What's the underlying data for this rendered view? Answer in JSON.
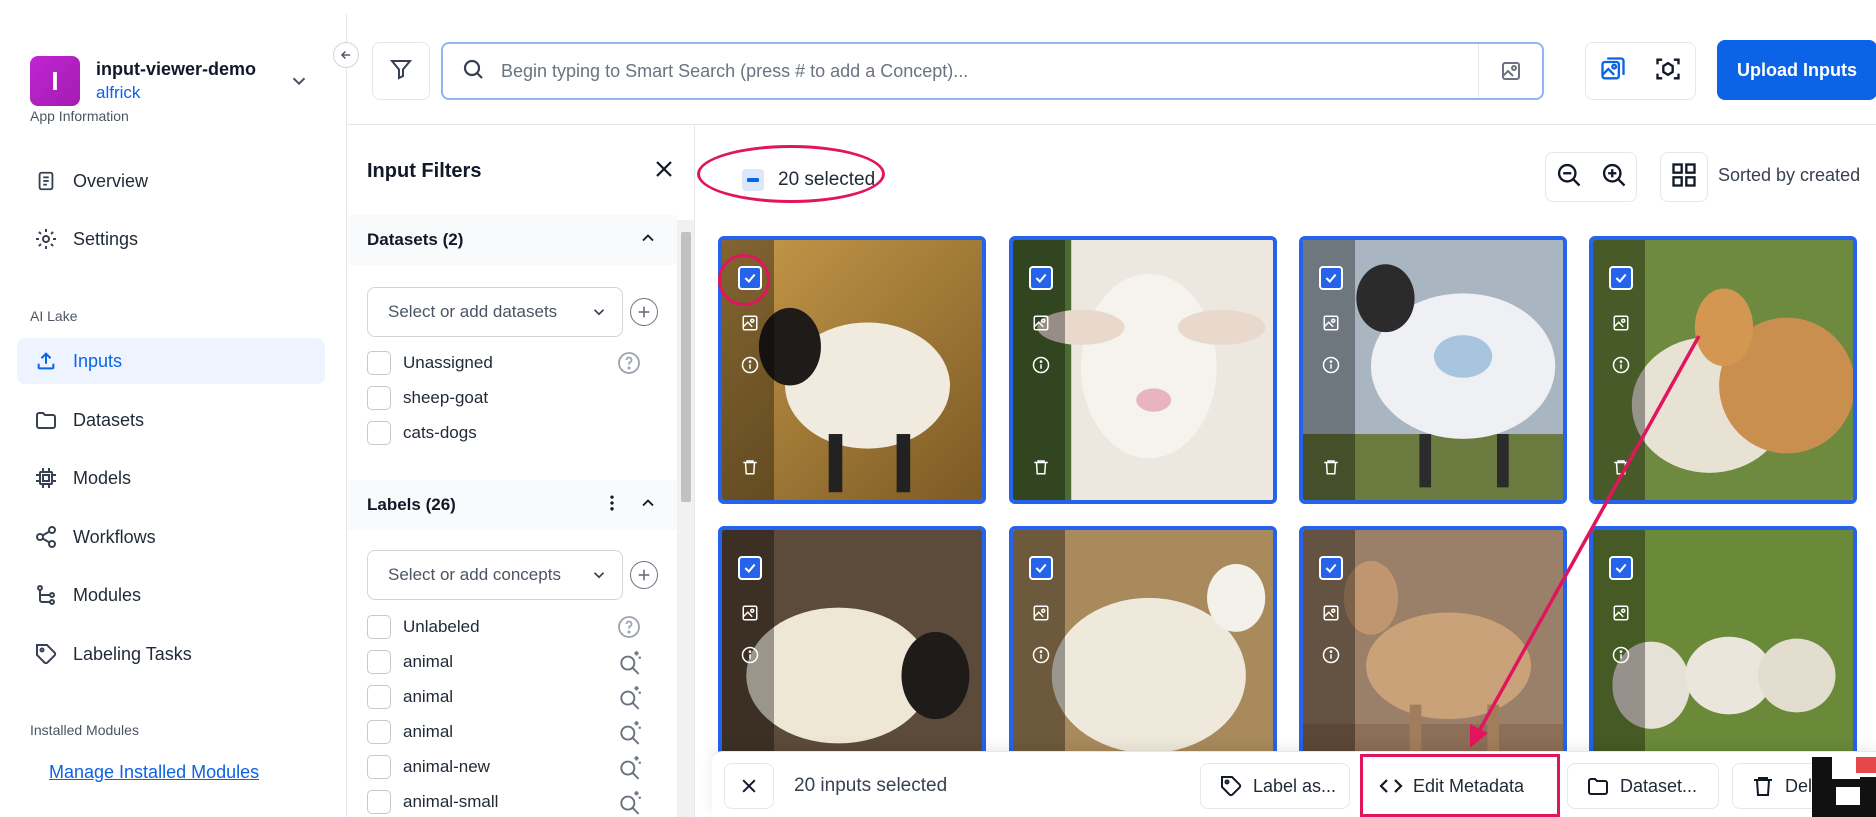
{
  "app": {
    "avatar_letter": "I",
    "name": "input-viewer-demo",
    "user": "alfrick"
  },
  "sidebar": {
    "section_app_info": "App Information",
    "section_ai_lake": "AI Lake",
    "section_installed": "Installed Modules",
    "items": [
      {
        "label": "Overview",
        "icon": "document-icon"
      },
      {
        "label": "Settings",
        "icon": "gear-icon"
      },
      {
        "label": "Inputs",
        "icon": "upload-icon",
        "active": true
      },
      {
        "label": "Datasets",
        "icon": "folder-icon"
      },
      {
        "label": "Models",
        "icon": "chip-icon"
      },
      {
        "label": "Workflows",
        "icon": "share-icon"
      },
      {
        "label": "Modules",
        "icon": "tree-icon"
      },
      {
        "label": "Labeling Tasks",
        "icon": "tag-icon"
      }
    ],
    "manage_link": "Manage Installed Modules"
  },
  "topbar": {
    "search_placeholder": "Begin typing to Smart Search (press # to add a Concept)...",
    "upload_label": "Upload Inputs"
  },
  "filters": {
    "title": "Input Filters",
    "datasets_header": "Datasets (2)",
    "datasets_select": "Select or add datasets",
    "dataset_options": [
      "Unassigned",
      "sheep-goat",
      "cats-dogs"
    ],
    "labels_header": "Labels (26)",
    "labels_select": "Select or add concepts",
    "label_options": [
      "Unlabeled",
      "animal",
      "animal",
      "animal",
      "animal-new",
      "animal-small"
    ]
  },
  "main": {
    "selected_label": "20 selected",
    "sorted_label": "Sorted by created",
    "tile_count": 8
  },
  "action_bar": {
    "count_label": "20 inputs selected",
    "label_as": "Label as...",
    "edit_metadata": "Edit Metadata",
    "datasets": "Dataset...",
    "delete": "Del"
  },
  "colors": {
    "accent": "#0b63e5",
    "tile_border": "#2563eb",
    "highlight": "#e0155d",
    "avatar": "#c026d3"
  }
}
